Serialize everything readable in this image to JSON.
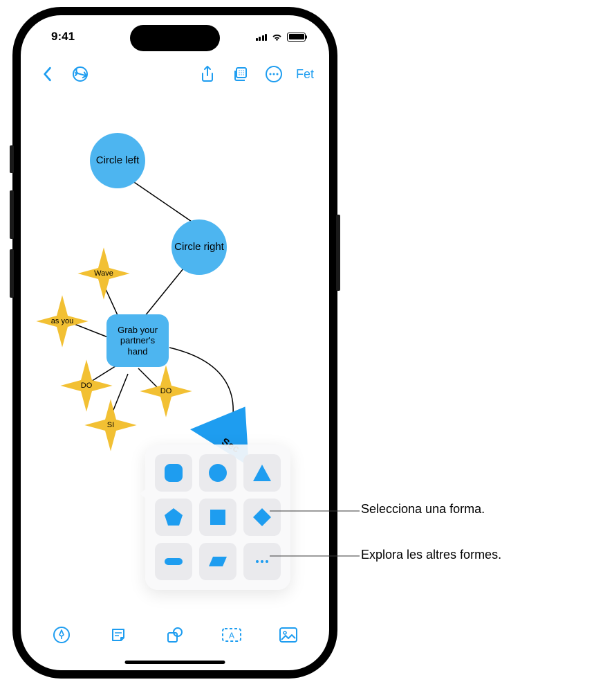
{
  "status": {
    "time": "9:41"
  },
  "toolbar": {
    "done": "Fet"
  },
  "nodes": {
    "circle_left": "Circle left",
    "circle_right": "Circle right",
    "grab": "Grab your partner's hand",
    "wave": "Wave",
    "as_you": "as you",
    "do1": "DO",
    "do2": "DO",
    "si": "SI",
    "sec_fragment": "Sec"
  },
  "callouts": {
    "select_shape": "Selecciona una forma.",
    "explore_more": "Explora les altres formes."
  },
  "icons": {
    "back": "back-chevron",
    "undo": "undo",
    "share": "share",
    "layers": "layers",
    "more": "more-horizontal",
    "pen": "pen",
    "note": "sticky-note",
    "shapes": "shapes",
    "textbox": "text-box",
    "media": "photo"
  }
}
